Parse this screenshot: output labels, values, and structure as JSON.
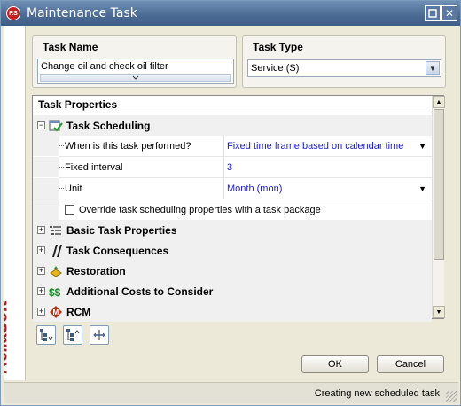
{
  "window": {
    "title": "Maintenance Task",
    "app_icon_text": "RS",
    "minimize_glyph": "▫",
    "close_glyph": "✕"
  },
  "brand": {
    "text": "ReliaSoft",
    "color": "#c01515"
  },
  "task_name": {
    "label": "Task Name",
    "value": "Change oil and check oil filter",
    "expander_glyph": "︾"
  },
  "task_type": {
    "label": "Task Type",
    "selected": "Service (S)",
    "dropdown_glyph": "▼"
  },
  "properties": {
    "header": "Task Properties",
    "scheduling": {
      "label": "Task Scheduling",
      "expand_glyph": "−",
      "rows": [
        {
          "name": "When is this task performed?",
          "value": "Fixed time frame based on calendar time",
          "has_dropdown": true
        },
        {
          "name": "Fixed interval",
          "value": "3",
          "has_dropdown": false
        },
        {
          "name": "Unit",
          "value": "Month (mon)",
          "has_dropdown": true
        }
      ],
      "override_checkbox": "Override task scheduling properties with a task package",
      "dropdown_glyph": "▼"
    },
    "categories": [
      {
        "label": "Basic Task Properties",
        "icon": "list-properties-icon",
        "expand_glyph": "+"
      },
      {
        "label": "Task Consequences",
        "icon": "consequences-icon",
        "expand_glyph": "+"
      },
      {
        "label": "Restoration",
        "icon": "restoration-icon",
        "expand_glyph": "+"
      },
      {
        "label": "Additional Costs to Consider",
        "icon": "costs-icon",
        "expand_glyph": "+"
      },
      {
        "label": "RCM",
        "icon": "rcm-icon",
        "expand_glyph": "+"
      }
    ],
    "scroll_up_glyph": "▲",
    "scroll_down_glyph": "▼"
  },
  "toolbar": {
    "buttons": [
      "expand-all-icon",
      "collapse-all-icon",
      "fit-columns-icon"
    ]
  },
  "buttons": {
    "ok": "OK",
    "cancel": "Cancel"
  },
  "status": {
    "text": "Creating new scheduled task"
  },
  "colors": {
    "title_bar": "#4a6a94",
    "value_text": "#1a1ae0",
    "brand": "#c01515"
  }
}
